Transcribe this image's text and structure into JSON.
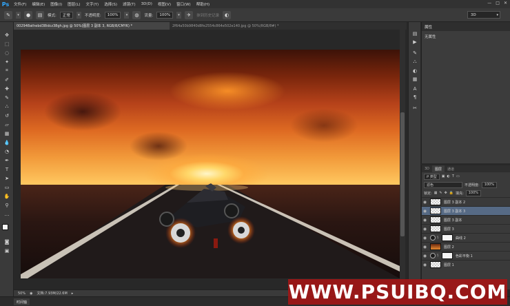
{
  "app": {
    "logo": "Ps"
  },
  "menu": [
    "文件(F)",
    "编辑(E)",
    "图像(I)",
    "图层(L)",
    "文字(Y)",
    "选择(S)",
    "滤镜(T)",
    "3D(D)",
    "视图(V)",
    "窗口(W)",
    "帮助(H)"
  ],
  "window_controls": [
    "—",
    "□",
    "✕"
  ],
  "options": {
    "mode_label": "模式:",
    "mode_value": "正常",
    "opacity_label": "不透明度:",
    "opacity_value": "100%",
    "flow_label": "流量:",
    "flow_value": "100%",
    "history_label": "抹到历史记录",
    "workspace": "3D"
  },
  "tabs": [
    {
      "label": "002948athebd38idcz38gh.jpg @ 50%(图层 3 副本 3, RGB/8/CMYK) *",
      "active": true
    },
    {
      "label": "2f64a50b9840d8fe2554c864e502e140.jpg @ 50%(RGB/8#) *",
      "active": false
    }
  ],
  "properties": {
    "title": "属性",
    "content": "无属性"
  },
  "layers_panel": {
    "tabs": [
      "3D",
      "图层",
      "通道"
    ],
    "kind_filter": "类型",
    "blend_mode": "滤色",
    "opacity_label": "不透明度:",
    "opacity_value": "100%",
    "lock_label": "锁定:",
    "fill_label": "填充:",
    "fill_value": "100%",
    "layers": [
      {
        "name": "图层 3 副本 2",
        "thumb": "trans",
        "selected": false,
        "adjustment": false
      },
      {
        "name": "图层 3 副本 3",
        "thumb": "trans",
        "selected": true,
        "adjustment": false
      },
      {
        "name": "图层 3 副本",
        "thumb": "trans",
        "selected": false,
        "adjustment": false
      },
      {
        "name": "图层 3",
        "thumb": "trans",
        "selected": false,
        "adjustment": false
      },
      {
        "name": "曲线 2",
        "thumb": "white",
        "selected": false,
        "adjustment": true
      },
      {
        "name": "图层 2",
        "thumb": "fire",
        "selected": false,
        "adjustment": false
      },
      {
        "name": "色彩平衡 1",
        "thumb": "white",
        "selected": false,
        "adjustment": true
      },
      {
        "name": "图层 1",
        "thumb": "trans",
        "selected": false,
        "adjustment": false
      }
    ]
  },
  "status": {
    "zoom": "50%",
    "doc": "文档:7.93M/22.6M"
  },
  "timeline": {
    "label": "时间轴"
  },
  "watermark": {
    "text": "WWW.PSUIBQ.COM"
  }
}
